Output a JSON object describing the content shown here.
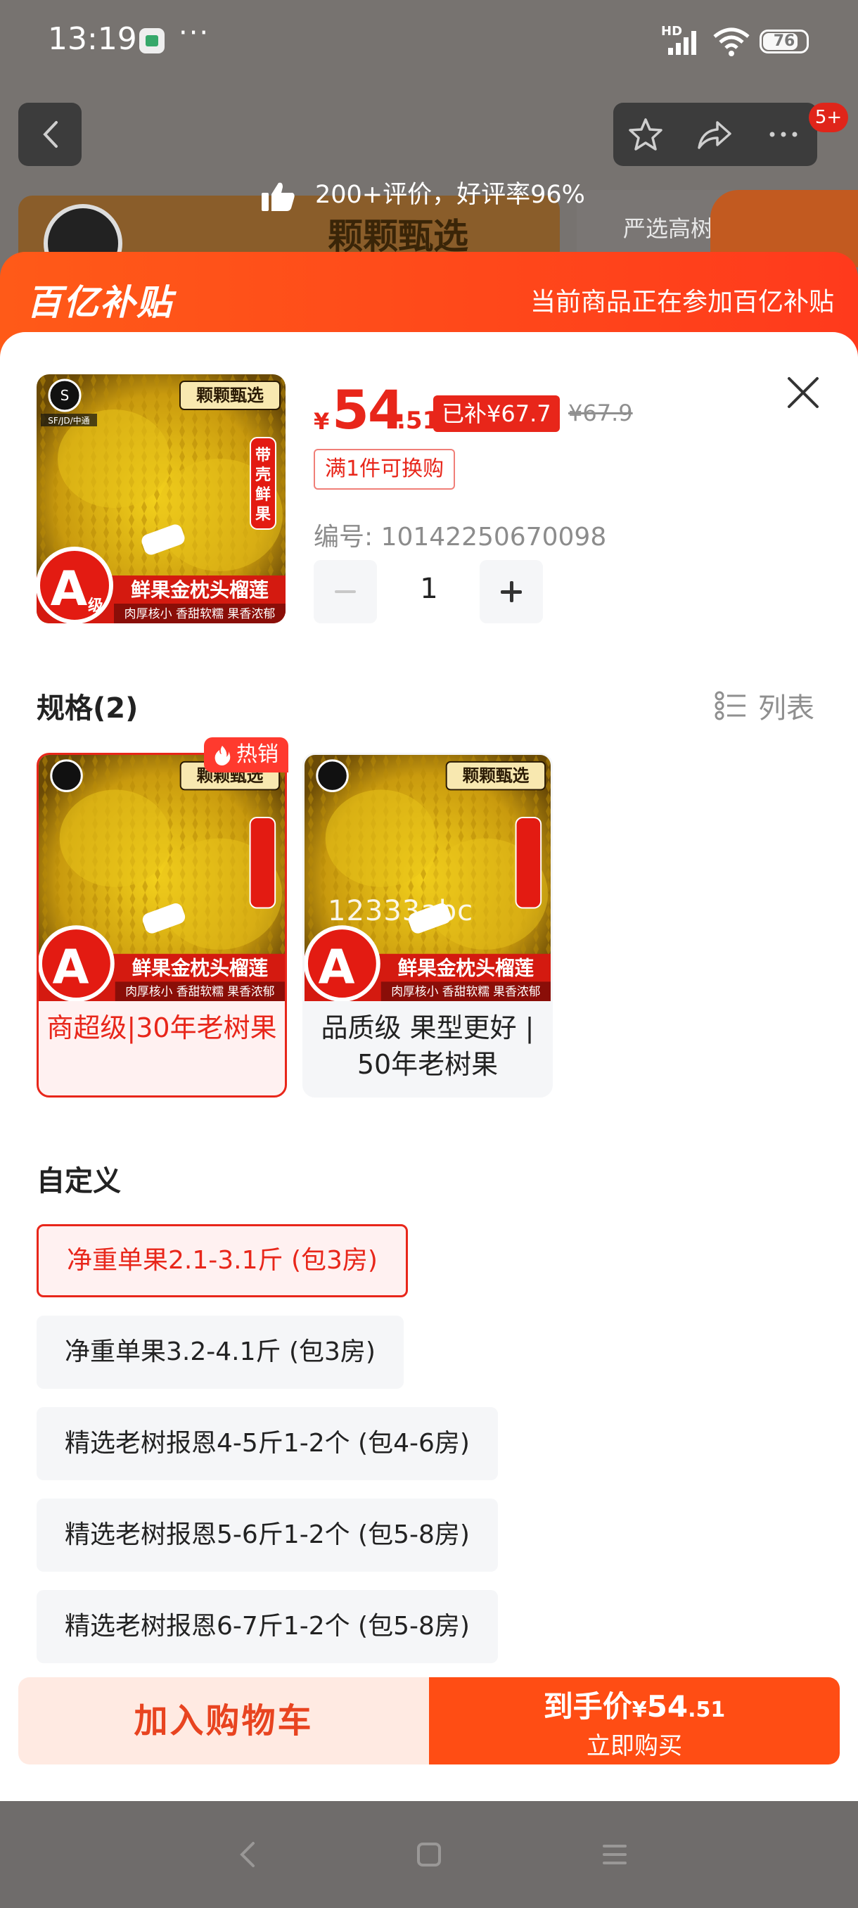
{
  "status_bar": {
    "time": "13:19",
    "more": "···",
    "network": "HD",
    "battery": "76",
    "battery_level": 0.76
  },
  "top_nav": {
    "badge": "5+"
  },
  "review_tip": "200+评价，好评率96%",
  "background_banner": {
    "left_title": "颗颗甄选",
    "right_title": "严选高树"
  },
  "subsidy": {
    "logo": "百亿补贴",
    "note": "当前商品正在参加百亿补贴"
  },
  "product": {
    "image_tag": "颗颗甄选",
    "image_side_tag": "带壳鲜果",
    "image_logistics": "SF/JD/中通",
    "image_name": "鲜果金枕头榴莲",
    "image_desc": "肉厚核小 香甜软糯 果香浓郁",
    "image_grade": "A",
    "image_grade_sub": "级",
    "price_currency": "¥",
    "price_int": "54",
    "price_dec": ".51",
    "subsidy_tag": "已补¥67.7",
    "original_price": "¥67.9",
    "promo": "满1件可换购",
    "sku_code": "编号: 10142250670098",
    "quantity": "1"
  },
  "spec": {
    "title": "规格(2)",
    "list_toggle": "列表",
    "hot_badge": "热销",
    "watermark": "12333abc",
    "items": [
      {
        "label": "商超级|30年老树果"
      },
      {
        "label": "品质级 果型更好 | 50年老树果"
      }
    ]
  },
  "custom": {
    "title": "自定义",
    "options": [
      {
        "label": "净重单果2.1-3.1斤 (包3房)"
      },
      {
        "label": "净重单果3.2-4.1斤 (包3房)"
      },
      {
        "label": "精选老树报恩4-5斤1-2个 (包4-6房)"
      },
      {
        "label": "精选老树报恩5-6斤1-2个 (包5-8房)"
      },
      {
        "label": "精选老树报恩6-7斤1-2个 (包5-8房)"
      }
    ]
  },
  "footer": {
    "add_cart": "加入购物车",
    "buy_price_prefix": "到手价",
    "buy_currency": "¥",
    "buy_price_int": "54",
    "buy_price_dec": ".51",
    "buy_now": "立即购买"
  },
  "colors": {
    "accent": "#e8261a",
    "subsidy_bar": "#ff4d14",
    "selected_bg": "#fff1f1"
  }
}
